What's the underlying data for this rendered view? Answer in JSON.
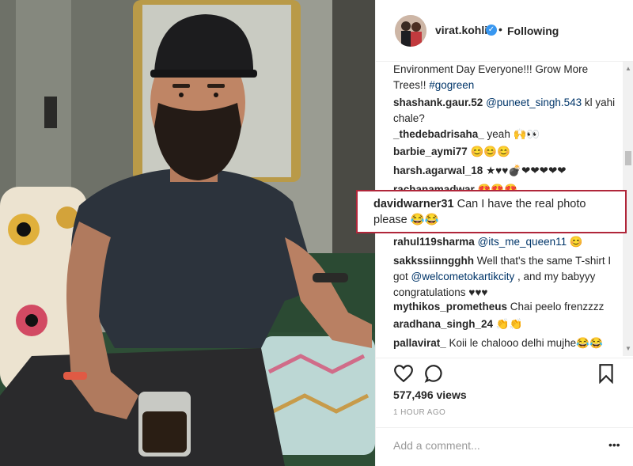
{
  "post": {
    "username": "virat.kohli",
    "dot": "•",
    "follow_label": "Following",
    "caption_text": "Environment Day Everyone!!! Grow More Trees!! ",
    "caption_hashtag": "#gogreen"
  },
  "comments": [
    {
      "user": "shashank.gaur.52",
      "mention": "@puneet_singh.543",
      "text": " kl yahi chale?"
    },
    {
      "user": "_thedebadrisaha_",
      "mention": "",
      "text": " yeah 🙌👀"
    },
    {
      "user": "barbie_aymi77",
      "mention": "",
      "text": " 😊😊😊"
    },
    {
      "user": "harsh.agarwal_18",
      "mention": "",
      "text": " ★♥♥💣❤❤❤❤❤"
    },
    {
      "user": "rachanamadwar",
      "mention": "",
      "text": " 😍😍😍"
    },
    {
      "user": "rahul119sharma",
      "mention": "@its_me_queen11",
      "text": " 😊"
    },
    {
      "user": "sakkssiinngghh",
      "mention": "",
      "text": " Well that's the same T-shirt I got "
    },
    {
      "user": "mythikos_prometheus",
      "mention": "",
      "text": " Chai peelo frenzzzz"
    },
    {
      "user": "aradhana_singh_24",
      "mention": "",
      "text": " 👏👏"
    },
    {
      "user": "pallavirat_",
      "mention": "",
      "text": " Koii le chalooo delhi mujhe😂😂"
    }
  ],
  "sakk_mention": "@welcometokartikcity",
  "sakk_tail": " , and my babyyy congratulations ♥♥♥",
  "highlighted_comment": {
    "user": "davidwarner31",
    "text": " Can I have the real photo please 😂😂"
  },
  "stats": {
    "views": "577,496 views",
    "time": "1 HOUR AGO"
  },
  "add_comment_placeholder": "Add a comment...",
  "more_label": "•••",
  "scroll_up_label": "▲",
  "scroll_down_label": "▼",
  "verified_mark": "✓",
  "icons": {
    "like": "heart-icon",
    "comment": "comment-icon",
    "save": "bookmark-icon",
    "verified": "verified-badge-icon"
  },
  "colors": {
    "link": "#003569",
    "verified": "#3897f0",
    "highlight_border": "#b0263a"
  }
}
